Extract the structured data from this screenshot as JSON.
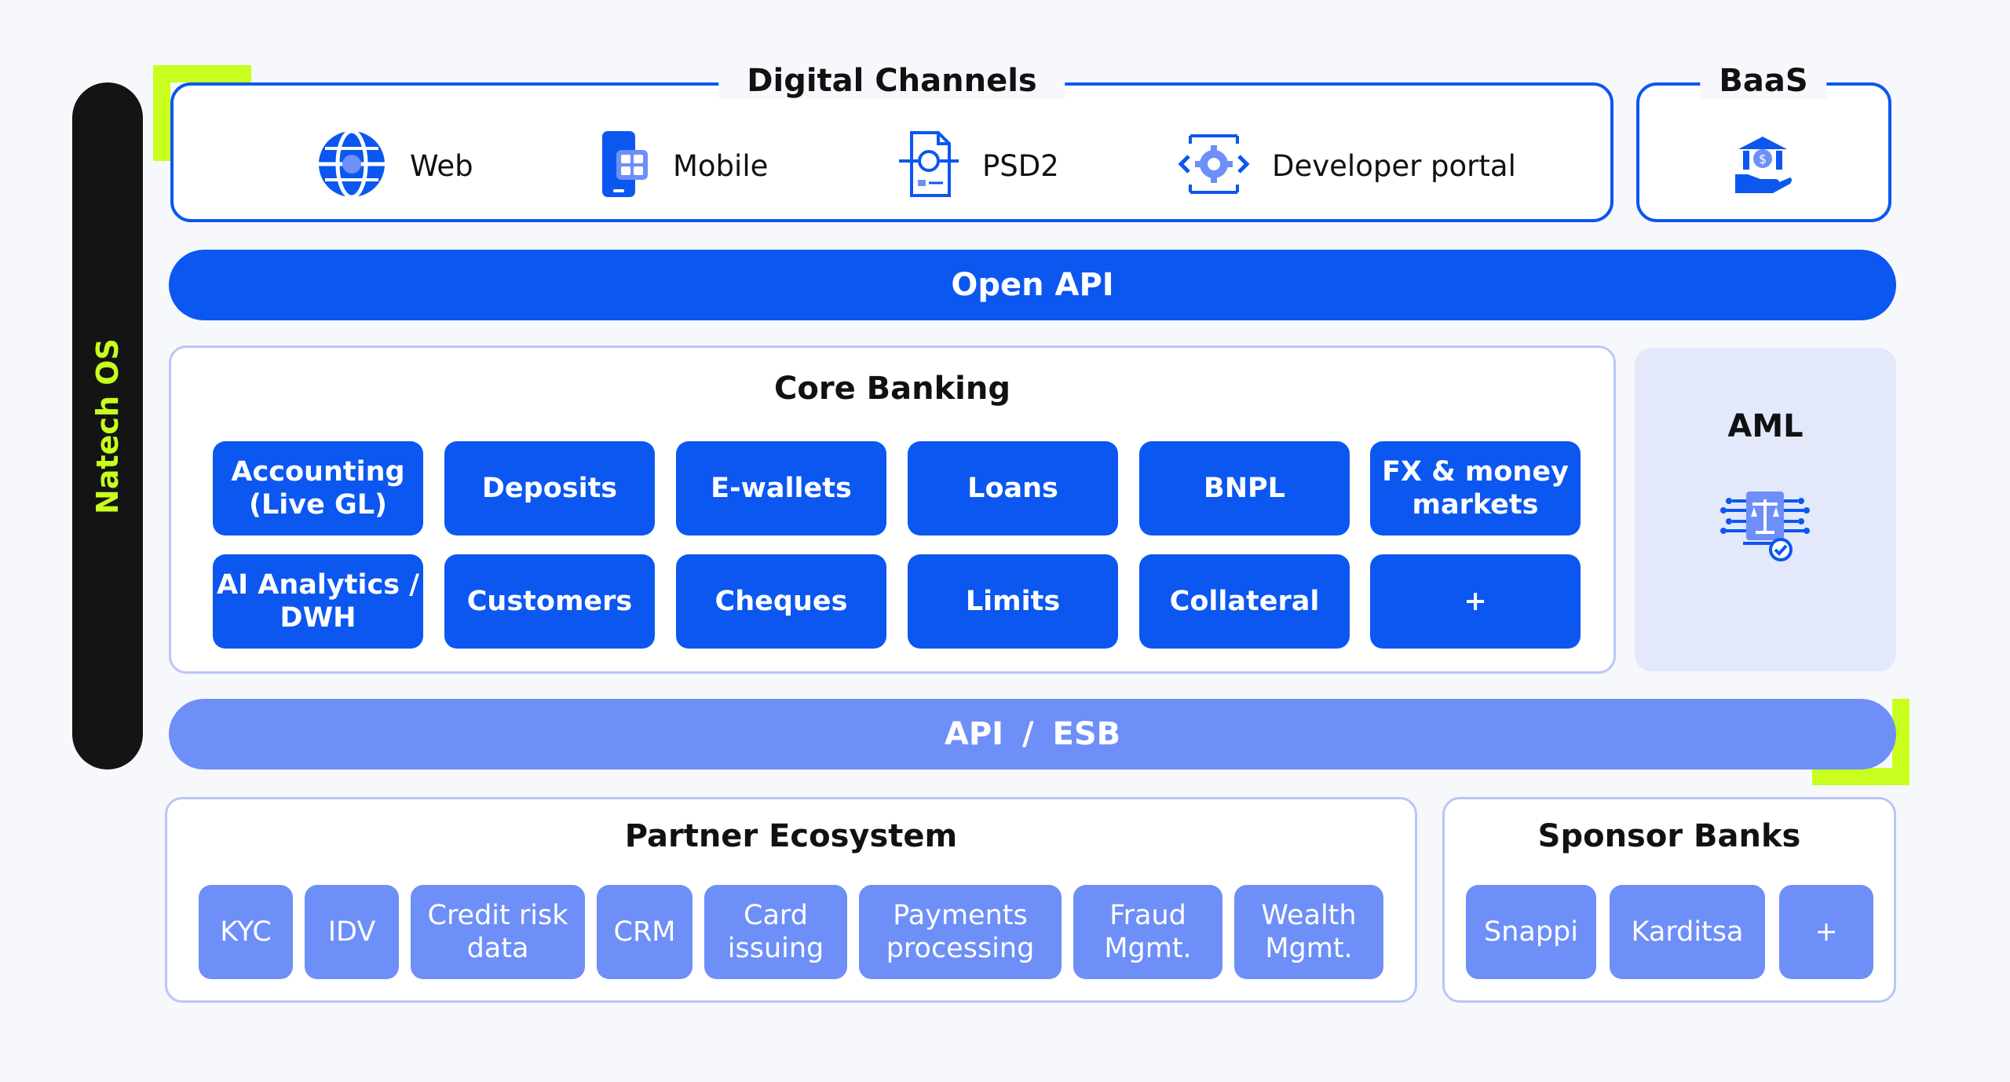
{
  "natech_os": {
    "label": "Natech OS"
  },
  "digital_channels": {
    "title": "Digital Channels",
    "items": [
      {
        "label": "Web",
        "icon": "globe-icon"
      },
      {
        "label": "Mobile",
        "icon": "mobile-icon"
      },
      {
        "label": "PSD2",
        "icon": "document-flow-icon"
      },
      {
        "label": "Developer portal",
        "icon": "gear-code-icon"
      }
    ]
  },
  "baas": {
    "title": "BaaS",
    "icon": "bank-hand-icon"
  },
  "open_api": {
    "label": "Open API"
  },
  "core_banking": {
    "title": "Core Banking",
    "tiles": [
      "Accounting\n(Live GL)",
      "Deposits",
      "E-wallets",
      "Loans",
      "BNPL",
      "FX & money\nmarkets",
      "AI Analytics /\nDWH",
      "Customers",
      "Cheques",
      "Limits",
      "Collateral",
      "+"
    ]
  },
  "aml": {
    "title": "AML",
    "icon": "compliance-scale-icon"
  },
  "api_esb": {
    "label": "API / ESB"
  },
  "partner_ecosystem": {
    "title": "Partner Ecosystem",
    "tiles": [
      "KYC",
      "IDV",
      "Credit risk\ndata",
      "CRM",
      "Card\nissuing",
      "Payments\nprocessing",
      "Fraud\nMgmt.",
      "Wealth\nMgmt."
    ]
  },
  "sponsor_banks": {
    "title": "Sponsor Banks",
    "tiles": [
      "Snappi",
      "Karditsa",
      "+"
    ]
  },
  "colors": {
    "primary": "#0b57f0",
    "secondary": "#6e8ff8",
    "accent": "#c8ff1e",
    "dark": "#141414"
  }
}
